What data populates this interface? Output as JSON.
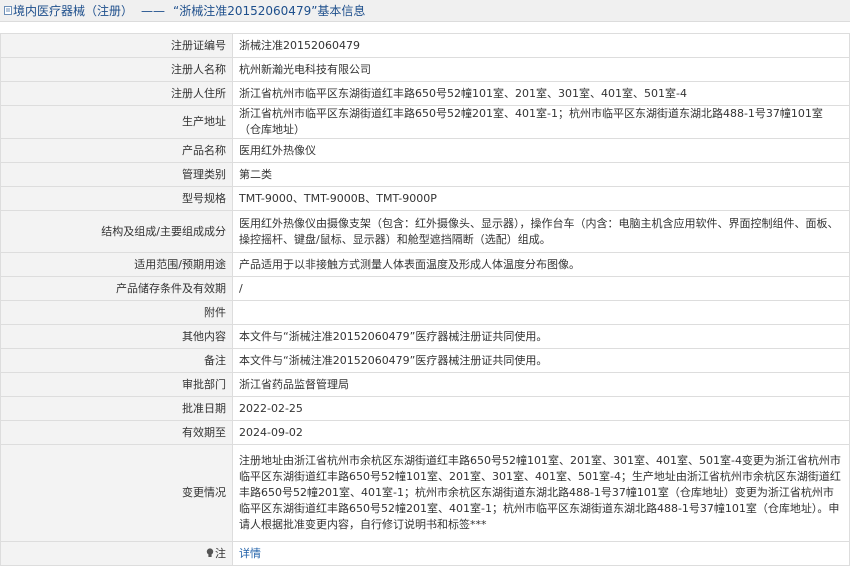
{
  "header": {
    "prefix": "境内医疗器械（注册）",
    "dash": "——",
    "name": "“浙械注准20152060479”基本信息"
  },
  "rows": [
    {
      "label": "注册证编号",
      "value": "浙械注准20152060479"
    },
    {
      "label": "注册人名称",
      "value": "杭州新瀚光电科技有限公司"
    },
    {
      "label": "注册人住所",
      "value": "浙江省杭州市临平区东湖街道红丰路650号52幢101室、201室、301室、401室、501室-4"
    },
    {
      "label": "生产地址",
      "value": "浙江省杭州市临平区东湖街道红丰路650号52幢201室、401室-1；杭州市临平区东湖街道东湖北路488-1号37幢101室（仓库地址）"
    },
    {
      "label": "产品名称",
      "value": "医用红外热像仪"
    },
    {
      "label": "管理类别",
      "value": "第二类"
    },
    {
      "label": "型号规格",
      "value": "TMT-9000、TMT-9000B、TMT-9000P"
    },
    {
      "label": "结构及组成/主要组成成分",
      "value": "医用红外热像仪由摄像支架（包含：红外摄像头、显示器），操作台车（内含：电脑主机含应用软件、界面控制组件、面板、操控摇杆、键盘/鼠标、显示器）和舱型遮挡隔断（选配）组成。"
    },
    {
      "label": "适用范围/预期用途",
      "value": "产品适用于以非接触方式测量人体表面温度及形成人体温度分布图像。"
    },
    {
      "label": "产品储存条件及有效期",
      "value": "/"
    },
    {
      "label": "附件",
      "value": ""
    },
    {
      "label": "其他内容",
      "value": "本文件与“浙械注准20152060479”医疗器械注册证共同使用。"
    },
    {
      "label": "备注",
      "value": "本文件与“浙械注准20152060479”医疗器械注册证共同使用。"
    },
    {
      "label": "审批部门",
      "value": "浙江省药品监督管理局"
    },
    {
      "label": "批准日期",
      "value": "2022-02-25"
    },
    {
      "label": "有效期至",
      "value": "2024-09-02"
    },
    {
      "label": "变更情况",
      "value": "注册地址由浙江省杭州市余杭区东湖街道红丰路650号52幢101室、201室、301室、401室、501室-4变更为浙江省杭州市临平区东湖街道红丰路650号52幢101室、201室、301室、401室、501室-4；生产地址由浙江省杭州市余杭区东湖街道红丰路650号52幢201室、401室-1；杭州市余杭区东湖街道东湖北路488-1号37幢101室（仓库地址）变更为浙江省杭州市临平区东湖街道红丰路650号52幢201室、401室-1；杭州市临平区东湖街道东湖北路488-1号37幢101室（仓库地址）。申请人根据批准变更内容，自行修订说明书和标签***"
    },
    {
      "label": "注",
      "value": "详情",
      "icon": "lightbulb-icon"
    }
  ],
  "colors": {
    "link": "#1e5fa8",
    "title": "#1e4f8c",
    "label_bg": "#f3f3f3",
    "border": "#dddddd"
  }
}
